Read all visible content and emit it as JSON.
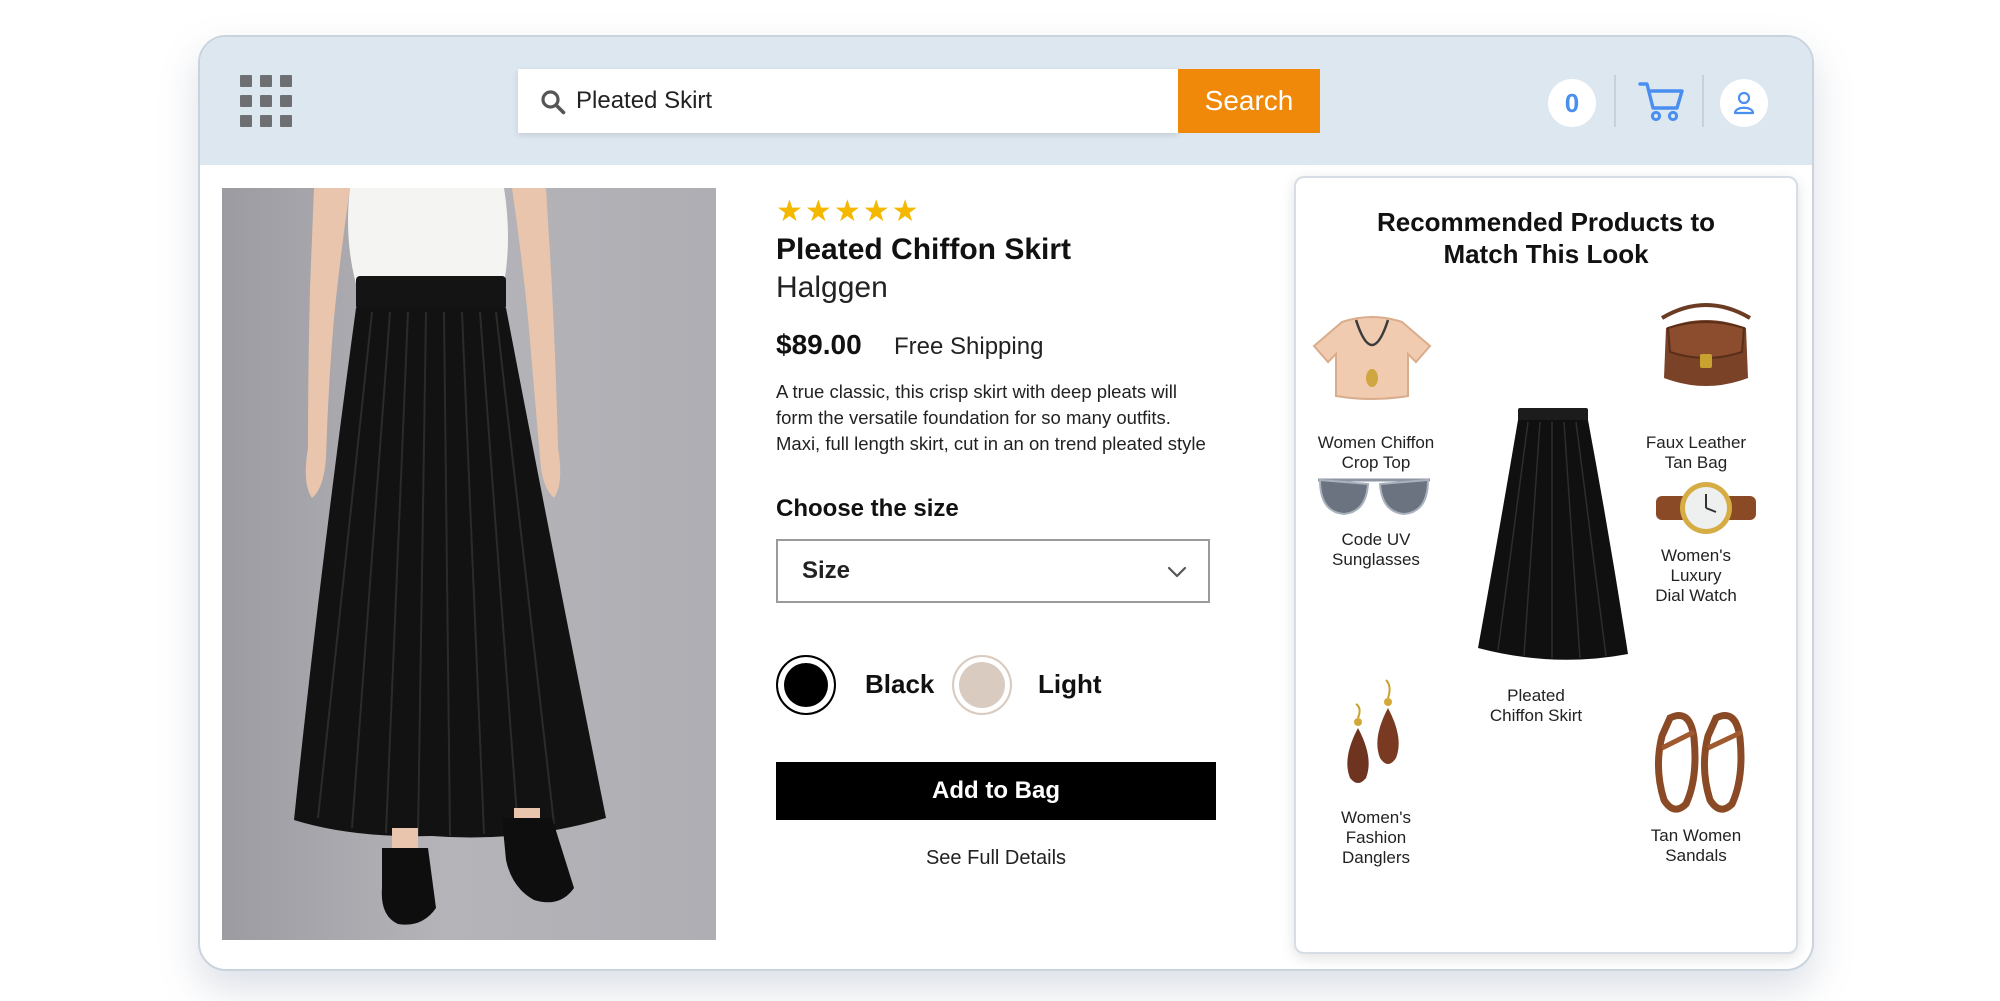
{
  "header": {
    "search": {
      "value": "Pleated Skirt",
      "button_label": "Search"
    },
    "wishlist_count": "0"
  },
  "product": {
    "rating_stars": 5,
    "title": "Pleated Chiffon Skirt",
    "brand": "Halggen",
    "price": "$89.00",
    "shipping": "Free Shipping",
    "description_lines": [
      "A true classic, this crisp skirt with deep pleats will",
      "form the versatile foundation for so many outfits.",
      "Maxi, full length skirt, cut in an on trend pleated style"
    ],
    "size_label": "Choose the size",
    "size_select": "Size",
    "colors": [
      {
        "name": "Black",
        "hex": "#000000"
      },
      {
        "name": "Light",
        "hex": "#d9cbc0"
      }
    ],
    "add_button": "Add to Bag",
    "details_link": "See Full Details"
  },
  "recommendations": {
    "title_lines": [
      "Recommended Products to",
      "Match This Look"
    ],
    "items": [
      {
        "label_lines": [
          "Women Chiffon",
          "Crop Top"
        ],
        "icon": "crop-top-icon"
      },
      {
        "label_lines": [
          "Code UV",
          "Sunglasses"
        ],
        "icon": "sunglasses-icon"
      },
      {
        "label_lines": [
          "Women's",
          "Fashion",
          "Danglers"
        ],
        "icon": "earrings-icon"
      },
      {
        "label_lines": [
          "Pleated",
          "Chiffon Skirt"
        ],
        "icon": "skirt-icon"
      },
      {
        "label_lines": [
          "Faux Leather",
          "Tan Bag"
        ],
        "icon": "bag-icon"
      },
      {
        "label_lines": [
          "Women's",
          "Luxury",
          "Dial Watch"
        ],
        "icon": "watch-icon"
      },
      {
        "label_lines": [
          "Tan Women",
          "Sandals"
        ],
        "icon": "sandals-icon"
      }
    ]
  },
  "colors": {
    "accent": "#f0880a",
    "topbar": "#dde7ef",
    "link_blue": "#4a8ff0",
    "star": "#f5b800"
  }
}
